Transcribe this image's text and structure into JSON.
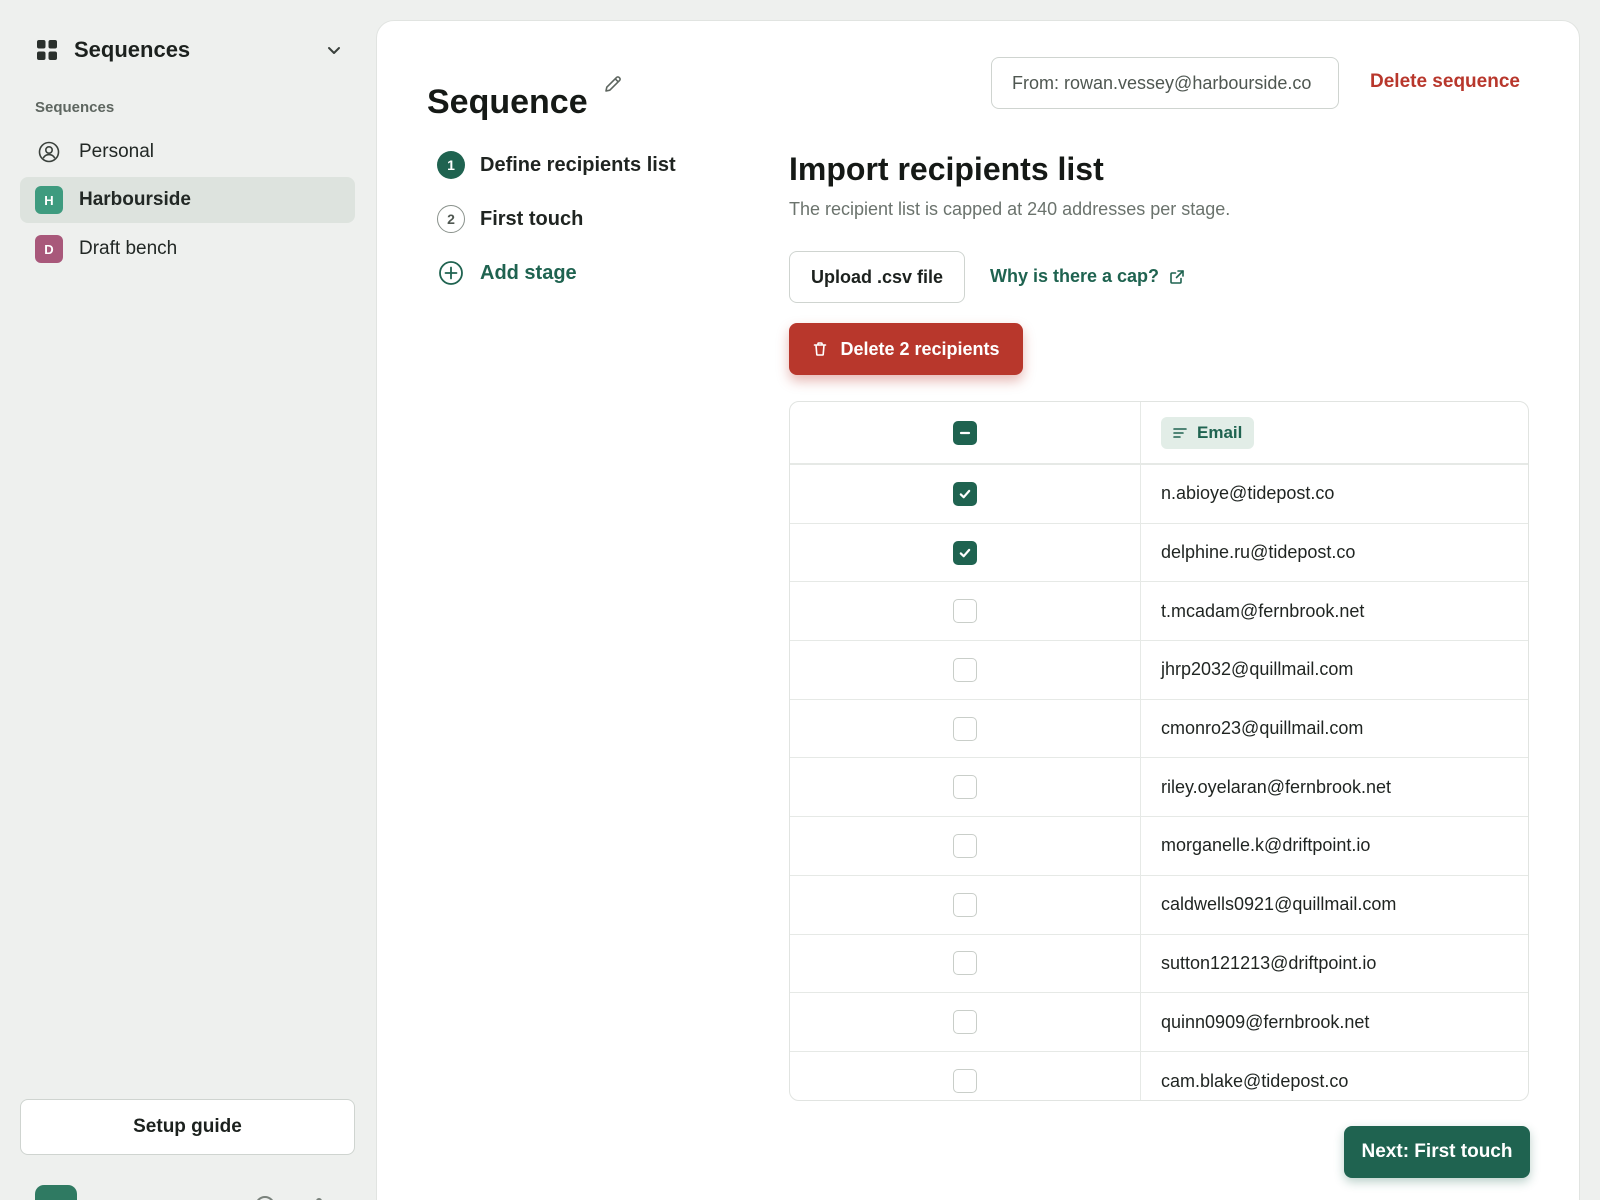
{
  "colors": {
    "accent": "#1f6350",
    "danger": "#b8372c",
    "sidebar_bg": "#eef0ee",
    "active_item_bg": "#dde3de"
  },
  "sidebar": {
    "workspace_title": "Sequences",
    "section_label": "Sequences",
    "items": [
      {
        "label": "Personal",
        "icon": "user-circle-icon"
      },
      {
        "label": "Harbourside",
        "badge": "H",
        "badge_color": "#3e9b7f",
        "active": true
      },
      {
        "label": "Draft bench",
        "badge": "D",
        "badge_color": "#a8587a"
      }
    ],
    "setup_guide_label": "Setup guide"
  },
  "header": {
    "title": "Sequence",
    "from_value": "From: rowan.vessey@harbourside.co",
    "delete_sequence_label": "Delete sequence"
  },
  "steps": [
    {
      "number": "1",
      "label": "Define recipients list",
      "active": true
    },
    {
      "number": "2",
      "label": "First touch"
    },
    {
      "label": "Add stage",
      "icon": "plus-circle-icon"
    }
  ],
  "import": {
    "title": "Import recipients list",
    "description": "The recipient list is capped at 240 addresses per stage.",
    "upload_label": "Upload .csv file",
    "cap_link_label": "Why is there a cap?",
    "delete_label": "Delete 2 recipients"
  },
  "table": {
    "email_header": "Email",
    "rows": [
      {
        "email": "n.abioye@tidepost.co",
        "checked": true
      },
      {
        "email": "delphine.ru@tidepost.co",
        "checked": true
      },
      {
        "email": "t.mcadam@fernbrook.net",
        "checked": false
      },
      {
        "email": "jhrp2032@quillmail.com",
        "checked": false
      },
      {
        "email": "cmonro23@quillmail.com",
        "checked": false
      },
      {
        "email": "riley.oyelaran@fernbrook.net",
        "checked": false
      },
      {
        "email": "morganelle.k@driftpoint.io",
        "checked": false
      },
      {
        "email": "caldwells0921@quillmail.com",
        "checked": false
      },
      {
        "email": "sutton121213@driftpoint.io",
        "checked": false
      },
      {
        "email": "quinn0909@fernbrook.net",
        "checked": false
      },
      {
        "email": "cam.blake@tidepost.co",
        "checked": false
      }
    ]
  },
  "footer": {
    "next_label": "Next: First touch"
  }
}
